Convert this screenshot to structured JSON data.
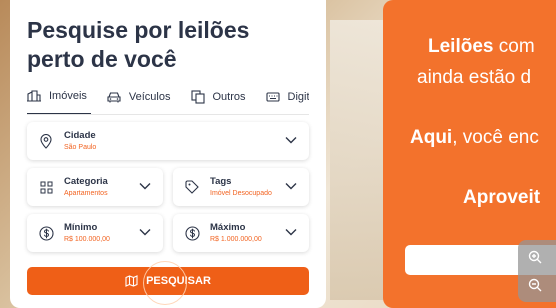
{
  "search_card": {
    "title": "Pesquise por leilões perto de você",
    "tabs": [
      {
        "label": "Imóveis",
        "icon": "building-icon",
        "active": true
      },
      {
        "label": "Veículos",
        "icon": "car-icon",
        "active": false
      },
      {
        "label": "Outros",
        "icon": "copy-icon",
        "active": false
      },
      {
        "label": "Digite",
        "icon": "keyboard-icon",
        "active": false
      }
    ],
    "city": {
      "label": "Cidade",
      "value": "São Paulo"
    },
    "category": {
      "label": "Categoria",
      "value": "Apartamentos"
    },
    "tags": {
      "label": "Tags",
      "value": "Imóvel Desocupado"
    },
    "min": {
      "label": "Mínimo",
      "value": "R$ 100.000,00"
    },
    "max": {
      "label": "Máximo",
      "value": "R$ 1.000.000,00"
    },
    "search_button": "PESQUISAR"
  },
  "promo": {
    "line1_bold": "Leilões",
    "line1_rest": " com",
    "line2": "ainda estão d",
    "line3_bold": "Aqui",
    "line3_rest": ", você enc",
    "line4": "Aproveit"
  },
  "colors": {
    "accent": "#ef5f17",
    "heading": "#2c3447",
    "promo_bg": "#f3722c"
  }
}
